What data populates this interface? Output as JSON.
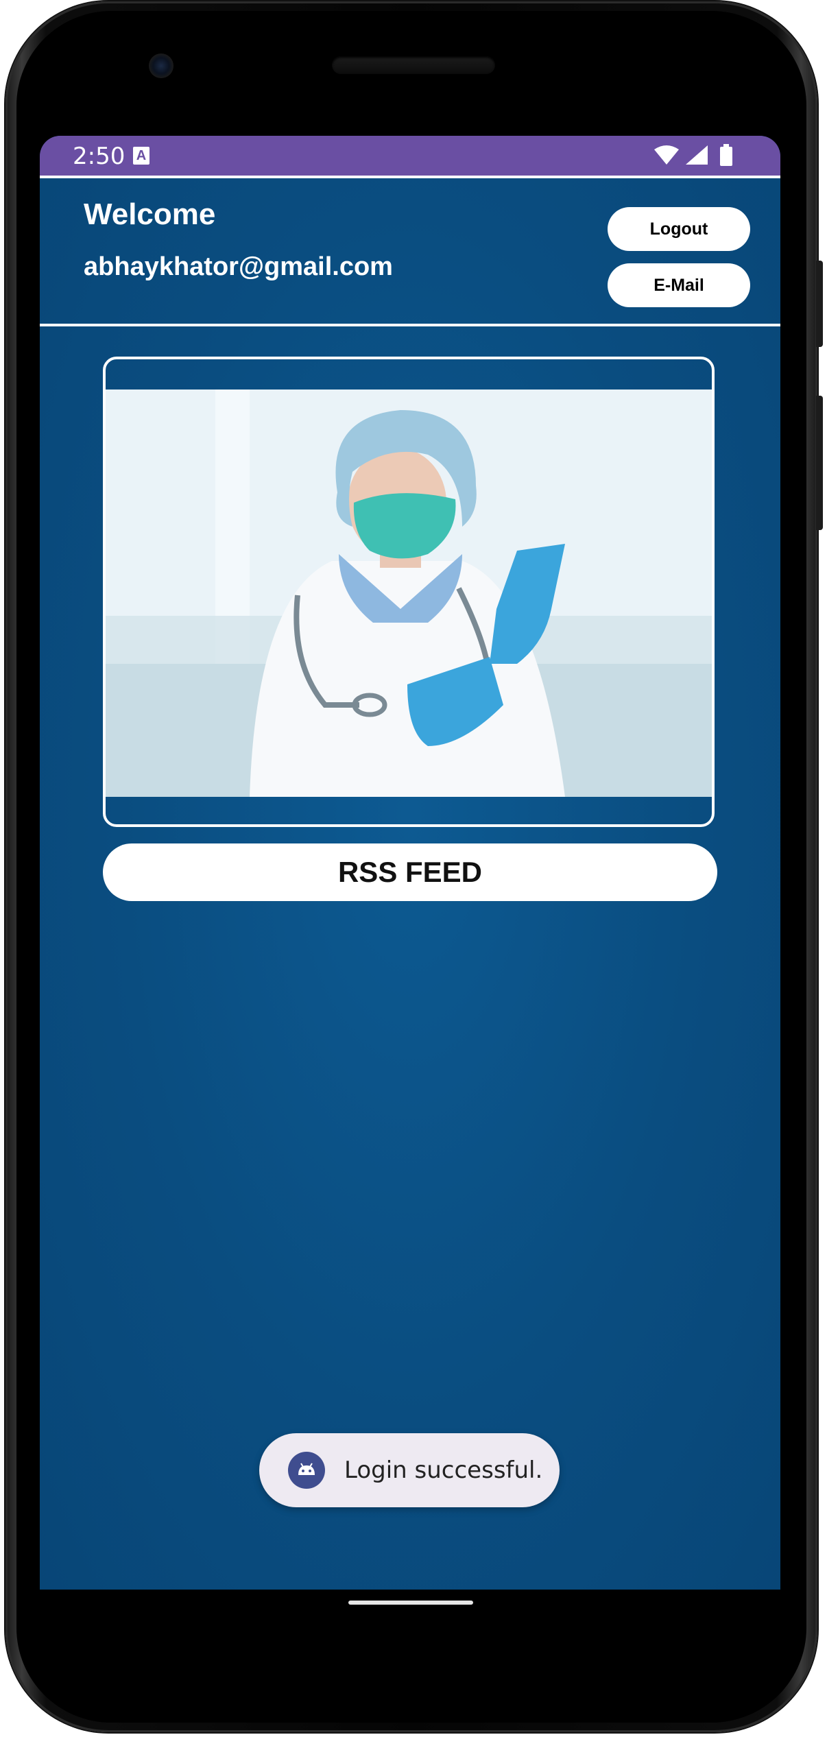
{
  "status_bar": {
    "time": "2:50",
    "notification_icon": "A",
    "icons": [
      "wifi-icon",
      "signal-icon",
      "battery-icon"
    ]
  },
  "header": {
    "welcome": "Welcome",
    "email": "abhaykhator@gmail.com",
    "logout_label": "Logout",
    "email_button_label": "E-Mail"
  },
  "main": {
    "image_alt": "doctor-with-mask-photo",
    "rss_button_label": "RSS FEED"
  },
  "toast": {
    "message": "Login successful.",
    "icon": "android-icon"
  },
  "colors": {
    "status_bar": "#6a4fa3",
    "background": "#0a4f84",
    "button": "#ffffff"
  }
}
